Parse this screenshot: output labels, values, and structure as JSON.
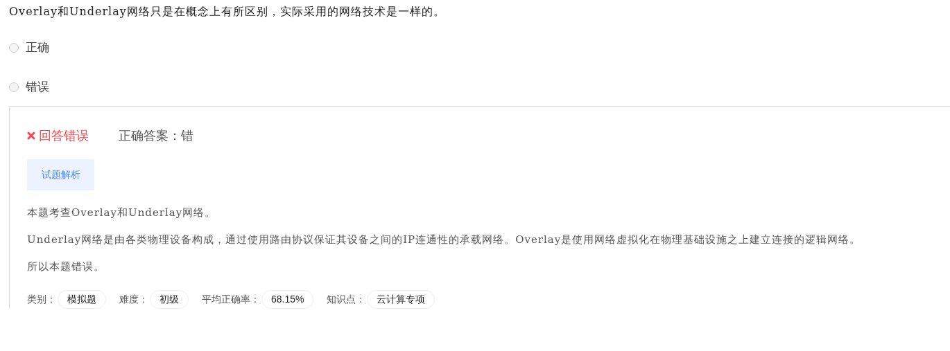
{
  "question": "Overlay和Underlay网络只是在概念上有所区别，实际采用的网络技术是一样的。",
  "options": [
    {
      "label": "正确",
      "selected": false
    },
    {
      "label": "错误",
      "selected": false
    }
  ],
  "result": {
    "kind": "wrong",
    "text": "回答错误",
    "answer": "正确答案：错"
  },
  "tab": {
    "label": "试题解析",
    "selected": true
  },
  "explanation": [
    "本题考查Overlay和Underlay网络。",
    "Underlay网络是由各类物理设备构成，通过使用路由协议保证其设备之间的IP连通性的承载网络。Overlay是使用网络虚拟化在物理基础设施之上建立连接的逻辑网络。",
    "所以本题错误。"
  ],
  "meta": [
    {
      "label": "类别：",
      "value": "模拟题"
    },
    {
      "label": "难度：",
      "value": "初级"
    },
    {
      "label": "平均正确率：",
      "value": "68.15%"
    },
    {
      "label": "知识点：",
      "value": "云计算专项"
    }
  ]
}
